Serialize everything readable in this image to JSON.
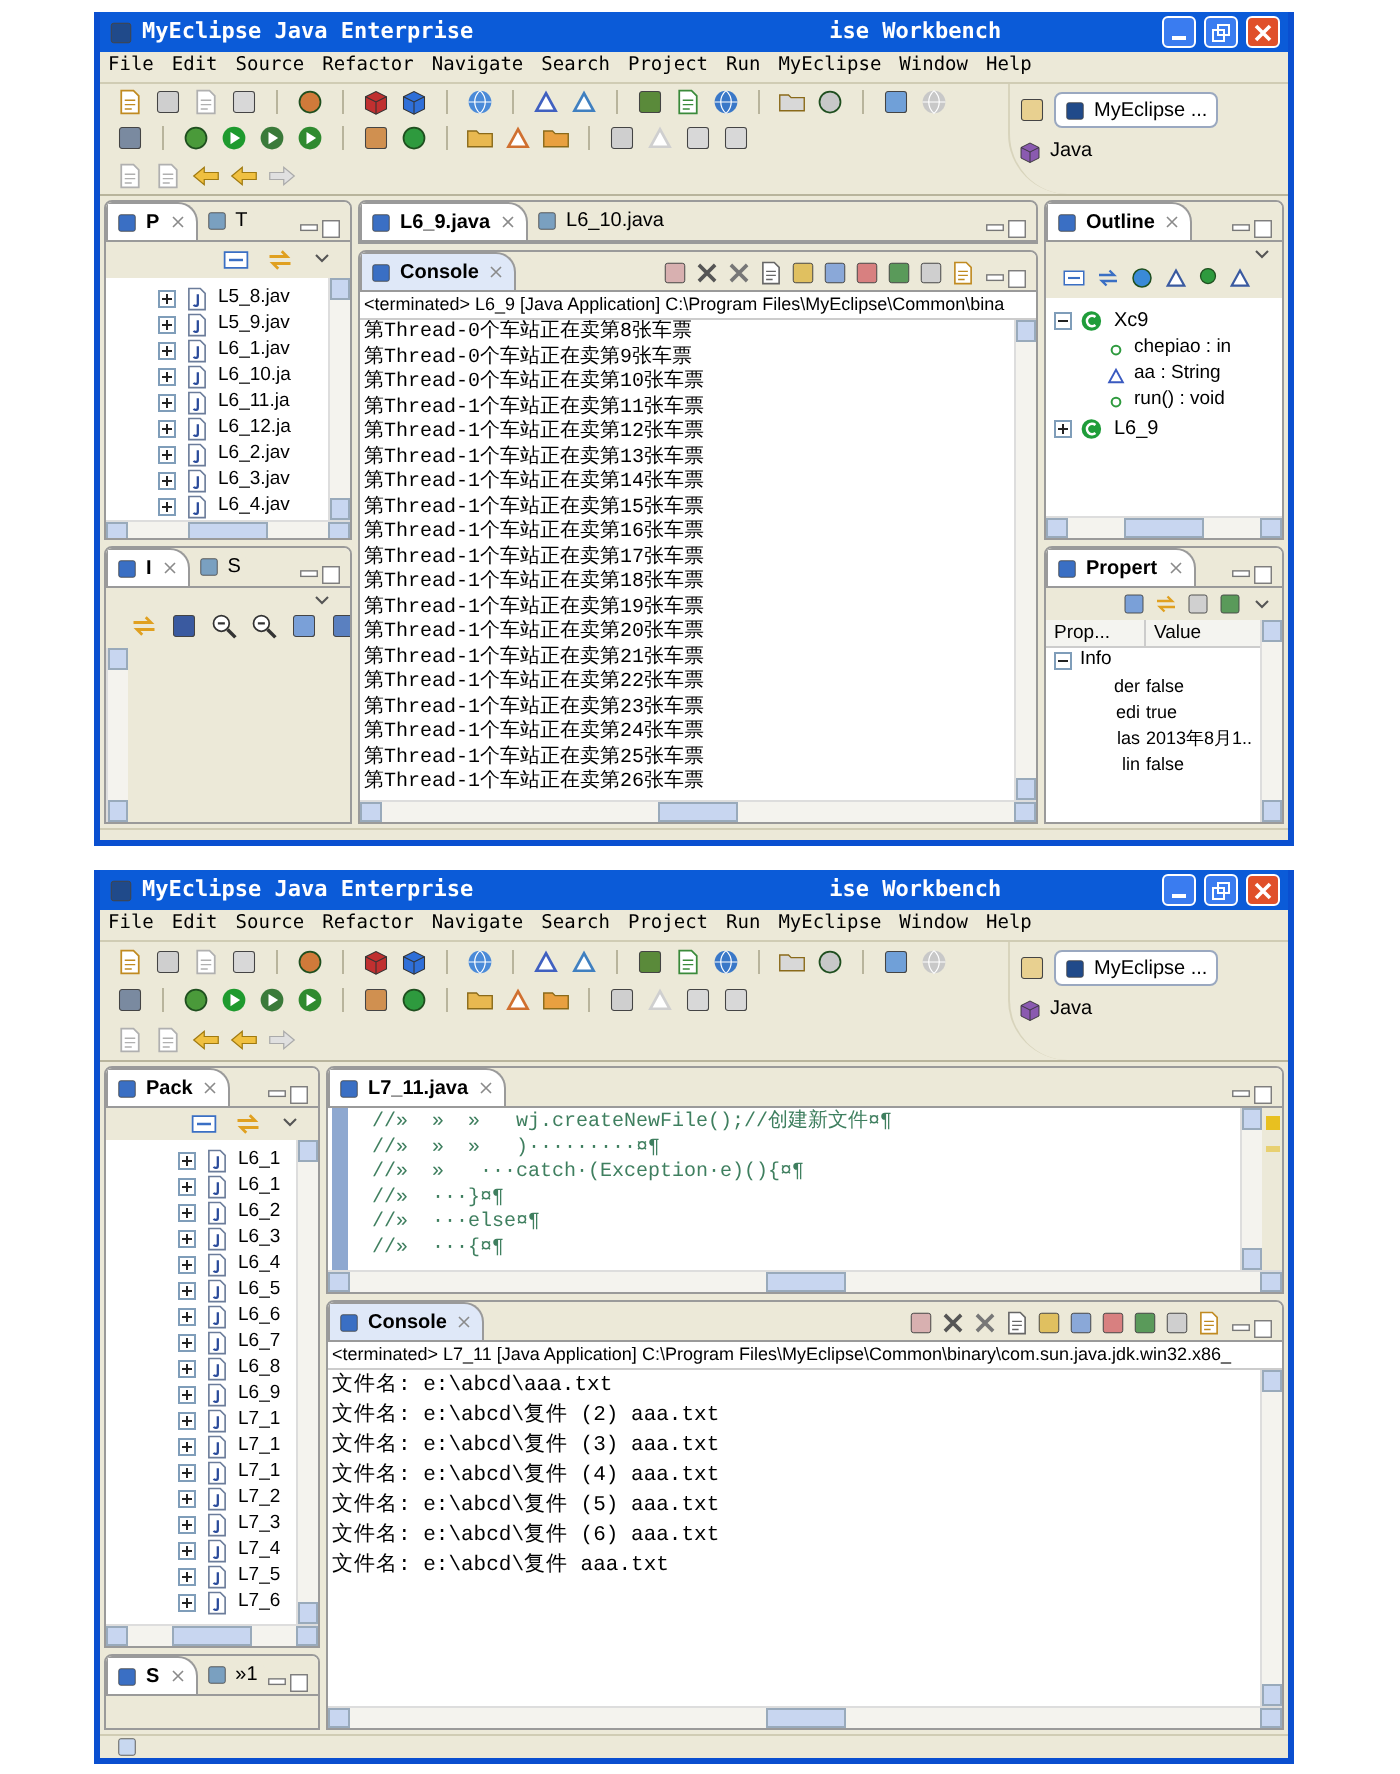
{
  "windows": [
    {
      "kind": "console-layout",
      "title_left": "MyEclipse Java Enterprise",
      "title_right": "ise Workbench",
      "menu": [
        "File",
        "Edit",
        "Source",
        "Refactor",
        "Navigate",
        "Search",
        "Project",
        "Run",
        "MyEclipse",
        "Window",
        "Help"
      ],
      "perspective": {
        "current": "MyEclipse ...",
        "other": "Java"
      },
      "left_top": {
        "tabs": [
          {
            "label": "P",
            "selected": true
          },
          {
            "label": "T",
            "selected": false
          }
        ],
        "items": [
          {
            "label": "L5_8.jav",
            "expanded": false
          },
          {
            "label": "L5_9.jav",
            "expanded": false
          },
          {
            "label": "L6_1.jav",
            "expanded": false
          },
          {
            "label": "L6_10.ja",
            "expanded": false
          },
          {
            "label": "L6_11.ja",
            "expanded": false
          },
          {
            "label": "L6_12.ja",
            "expanded": false
          },
          {
            "label": "L6_2.jav",
            "expanded": false
          },
          {
            "label": "L6_3.jav",
            "expanded": false
          },
          {
            "label": "L6_4.jav",
            "expanded": false
          }
        ]
      },
      "left_bottom": {
        "tabs": [
          {
            "label": "I",
            "selected": true
          },
          {
            "label": "S",
            "selected": false
          }
        ]
      },
      "editor": {
        "tabs": [
          {
            "label": "L6_9.java",
            "selected": true
          },
          {
            "label": "L6_10.java",
            "selected": false
          }
        ]
      },
      "console": {
        "tab": "Console",
        "header": "<terminated> L6_9 [Java Application] C:\\Program Files\\MyEclipse\\Common\\bina",
        "lines": [
          "第Thread-0个车站正在卖第8张车票",
          "第Thread-0个车站正在卖第9张车票",
          "第Thread-0个车站正在卖第10张车票",
          "第Thread-1个车站正在卖第11张车票",
          "第Thread-1个车站正在卖第12张车票",
          "第Thread-1个车站正在卖第13张车票",
          "第Thread-1个车站正在卖第14张车票",
          "第Thread-1个车站正在卖第15张车票",
          "第Thread-1个车站正在卖第16张车票",
          "第Thread-1个车站正在卖第17张车票",
          "第Thread-1个车站正在卖第18张车票",
          "第Thread-1个车站正在卖第19张车票",
          "第Thread-1个车站正在卖第20张车票",
          "第Thread-1个车站正在卖第21张车票",
          "第Thread-1个车站正在卖第22张车票",
          "第Thread-1个车站正在卖第23张车票",
          "第Thread-1个车站正在卖第24张车票",
          "第Thread-1个车站正在卖第25张车票",
          "第Thread-1个车站正在卖第26张车票"
        ]
      },
      "outline": {
        "tab": "Outline",
        "items": [
          {
            "label": "Xc9",
            "expanded": true,
            "children": [
              {
                "label": "chepiao : in"
              },
              {
                "label": "aa : String"
              },
              {
                "label": "run() : void"
              }
            ]
          },
          {
            "label": "L6_9",
            "expanded": false
          }
        ]
      },
      "properties": {
        "tab": "Propert",
        "columns": [
          "Prop...",
          "Value"
        ],
        "groups": [
          {
            "label": "Info",
            "expanded": true,
            "rows": [
              [
                "der",
                "false"
              ],
              [
                "edi",
                "true"
              ],
              [
                "las",
                "2013年8月1.."
              ],
              [
                "lin",
                "false"
              ]
            ]
          }
        ]
      }
    },
    {
      "kind": "editor-layout",
      "title_left": "MyEclipse Java Enterprise",
      "title_right": "ise Workbench",
      "menu": [
        "File",
        "Edit",
        "Source",
        "Refactor",
        "Navigate",
        "Search",
        "Project",
        "Run",
        "MyEclipse",
        "Window",
        "Help"
      ],
      "perspective": {
        "current": "MyEclipse ...",
        "other": "Java"
      },
      "left_top": {
        "tabs": [
          {
            "label": "Pack",
            "selected": true
          }
        ],
        "items": [
          {
            "label": "L6_1",
            "expanded": false
          },
          {
            "label": "L6_1",
            "expanded": false
          },
          {
            "label": "L6_2",
            "expanded": false
          },
          {
            "label": "L6_3",
            "expanded": false
          },
          {
            "label": "L6_4",
            "expanded": false
          },
          {
            "label": "L6_5",
            "expanded": false
          },
          {
            "label": "L6_6",
            "expanded": false
          },
          {
            "label": "L6_7",
            "expanded": false
          },
          {
            "label": "L6_8",
            "expanded": false
          },
          {
            "label": "L6_9",
            "expanded": false
          },
          {
            "label": "L7_1",
            "expanded": false
          },
          {
            "label": "L7_1",
            "expanded": false
          },
          {
            "label": "L7_1",
            "expanded": false
          },
          {
            "label": "L7_2",
            "expanded": false
          },
          {
            "label": "L7_3",
            "expanded": false
          },
          {
            "label": "L7_4",
            "expanded": false
          },
          {
            "label": "L7_5",
            "expanded": false
          },
          {
            "label": "L7_6",
            "expanded": false
          }
        ]
      },
      "left_bottom": {
        "tabs": [
          {
            "label": "S",
            "selected": true
          },
          {
            "label": "»1",
            "selected": false
          }
        ]
      },
      "editor": {
        "tabs": [
          {
            "label": "L7_11.java",
            "selected": true
          }
        ],
        "code": [
          "//»  »  »   wj.createNewFile();//创建新文件¤¶",
          "//»  »  »   )·········¤¶",
          "//»  »   ···catch·(Exception·e)(){¤¶",
          "//»  ···}¤¶",
          "//»  ···else¤¶",
          "//»  ···{¤¶"
        ]
      },
      "console": {
        "tab": "Console",
        "header": "<terminated> L7_11 [Java Application] C:\\Program Files\\MyEclipse\\Common\\binary\\com.sun.java.jdk.win32.x86_",
        "lines": [
          "文件名: e:\\abcd\\aaa.txt",
          "文件名: e:\\abcd\\复件 (2) aaa.txt",
          "文件名: e:\\abcd\\复件 (3) aaa.txt",
          "文件名: e:\\abcd\\复件 (4) aaa.txt",
          "文件名: e:\\abcd\\复件 (5) aaa.txt",
          "文件名: e:\\abcd\\复件 (6) aaa.txt",
          "文件名: e:\\abcd\\复件 aaa.txt"
        ]
      }
    }
  ]
}
